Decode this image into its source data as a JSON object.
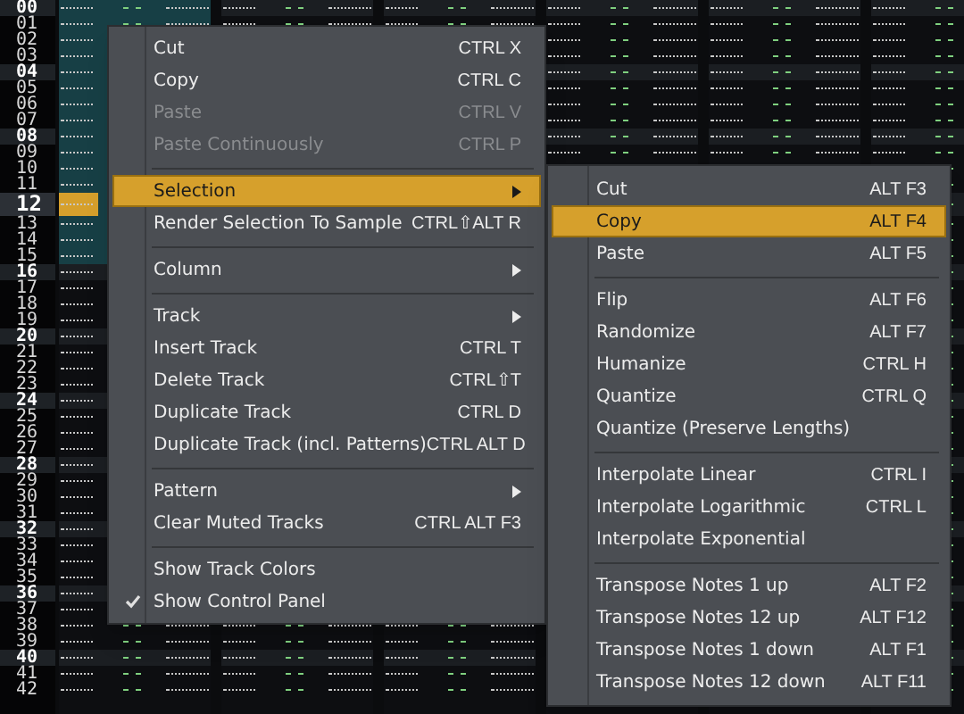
{
  "pattern": {
    "tracks": [
      {
        "selected": true
      },
      {
        "selected": false
      },
      {
        "selected": false
      },
      {
        "selected": false
      },
      {
        "selected": false
      },
      {
        "selected": false
      }
    ],
    "rows": [
      {
        "number": "00",
        "beat": true,
        "cursor": false,
        "selected": true
      },
      {
        "number": "01",
        "beat": false,
        "cursor": false,
        "selected": true
      },
      {
        "number": "02",
        "beat": false,
        "cursor": false,
        "selected": true
      },
      {
        "number": "03",
        "beat": false,
        "cursor": false,
        "selected": true
      },
      {
        "number": "04",
        "beat": true,
        "cursor": false,
        "selected": true
      },
      {
        "number": "05",
        "beat": false,
        "cursor": false,
        "selected": true
      },
      {
        "number": "06",
        "beat": false,
        "cursor": false,
        "selected": true
      },
      {
        "number": "07",
        "beat": false,
        "cursor": false,
        "selected": true
      },
      {
        "number": "08",
        "beat": true,
        "cursor": false,
        "selected": true
      },
      {
        "number": "09",
        "beat": false,
        "cursor": false,
        "selected": true
      },
      {
        "number": "10",
        "beat": false,
        "cursor": false,
        "selected": true
      },
      {
        "number": "11",
        "beat": false,
        "cursor": false,
        "selected": true
      },
      {
        "number": "12",
        "beat": true,
        "cursor": true,
        "selected": true
      },
      {
        "number": "13",
        "beat": false,
        "cursor": false,
        "selected": true
      },
      {
        "number": "14",
        "beat": false,
        "cursor": false,
        "selected": true
      },
      {
        "number": "15",
        "beat": false,
        "cursor": false,
        "selected": true
      },
      {
        "number": "16",
        "beat": true,
        "cursor": false,
        "selected": false
      },
      {
        "number": "17",
        "beat": false,
        "cursor": false,
        "selected": false
      },
      {
        "number": "18",
        "beat": false,
        "cursor": false,
        "selected": false
      },
      {
        "number": "19",
        "beat": false,
        "cursor": false,
        "selected": false
      },
      {
        "number": "20",
        "beat": true,
        "cursor": false,
        "selected": false
      },
      {
        "number": "21",
        "beat": false,
        "cursor": false,
        "selected": false
      },
      {
        "number": "22",
        "beat": false,
        "cursor": false,
        "selected": false
      },
      {
        "number": "23",
        "beat": false,
        "cursor": false,
        "selected": false
      },
      {
        "number": "24",
        "beat": true,
        "cursor": false,
        "selected": false
      },
      {
        "number": "25",
        "beat": false,
        "cursor": false,
        "selected": false
      },
      {
        "number": "26",
        "beat": false,
        "cursor": false,
        "selected": false
      },
      {
        "number": "27",
        "beat": false,
        "cursor": false,
        "selected": false
      },
      {
        "number": "28",
        "beat": true,
        "cursor": false,
        "selected": false
      },
      {
        "number": "29",
        "beat": false,
        "cursor": false,
        "selected": false
      },
      {
        "number": "30",
        "beat": false,
        "cursor": false,
        "selected": false
      },
      {
        "number": "31",
        "beat": false,
        "cursor": false,
        "selected": false
      },
      {
        "number": "32",
        "beat": true,
        "cursor": false,
        "selected": false
      },
      {
        "number": "33",
        "beat": false,
        "cursor": false,
        "selected": false
      },
      {
        "number": "34",
        "beat": false,
        "cursor": false,
        "selected": false
      },
      {
        "number": "35",
        "beat": false,
        "cursor": false,
        "selected": false
      },
      {
        "number": "36",
        "beat": true,
        "cursor": false,
        "selected": false
      },
      {
        "number": "37",
        "beat": false,
        "cursor": false,
        "selected": false
      },
      {
        "number": "38",
        "beat": false,
        "cursor": false,
        "selected": false
      },
      {
        "number": "39",
        "beat": false,
        "cursor": false,
        "selected": false
      },
      {
        "number": "40",
        "beat": true,
        "cursor": false,
        "selected": false
      },
      {
        "number": "41",
        "beat": false,
        "cursor": false,
        "selected": false
      },
      {
        "number": "42",
        "beat": false,
        "cursor": false,
        "selected": false
      }
    ]
  },
  "context_menu": {
    "items": [
      {
        "kind": "action",
        "label": "Cut",
        "shortcut": "CTRL X",
        "disabled": false
      },
      {
        "kind": "action",
        "label": "Copy",
        "shortcut": "CTRL C",
        "disabled": false
      },
      {
        "kind": "action",
        "label": "Paste",
        "shortcut": "CTRL V",
        "disabled": true
      },
      {
        "kind": "action",
        "label": "Paste Continuously",
        "shortcut": "CTRL P",
        "disabled": true
      },
      {
        "kind": "separator"
      },
      {
        "kind": "submenu",
        "label": "Selection",
        "selected": true
      },
      {
        "kind": "action",
        "label": "Render Selection To Sample",
        "shortcut": "CTRL⇧ALT R",
        "disabled": false
      },
      {
        "kind": "separator"
      },
      {
        "kind": "submenu",
        "label": "Column",
        "selected": false
      },
      {
        "kind": "separator"
      },
      {
        "kind": "submenu",
        "label": "Track",
        "selected": false
      },
      {
        "kind": "action",
        "label": "Insert Track",
        "shortcut": "CTRL T",
        "disabled": false
      },
      {
        "kind": "action",
        "label": "Delete Track",
        "shortcut": "CTRL⇧T",
        "disabled": false
      },
      {
        "kind": "action",
        "label": "Duplicate Track",
        "shortcut": "CTRL D",
        "disabled": false
      },
      {
        "kind": "action",
        "label": "Duplicate Track (incl. Patterns)",
        "shortcut": "CTRL ALT D",
        "disabled": false
      },
      {
        "kind": "separator"
      },
      {
        "kind": "submenu",
        "label": "Pattern",
        "selected": false
      },
      {
        "kind": "action",
        "label": "Clear Muted Tracks",
        "shortcut": "CTRL ALT F3",
        "disabled": false
      },
      {
        "kind": "separator"
      },
      {
        "kind": "toggle",
        "label": "Show Track Colors",
        "checked": false
      },
      {
        "kind": "toggle",
        "label": "Show Control Panel",
        "checked": true
      }
    ]
  },
  "selection_submenu": {
    "items": [
      {
        "kind": "action",
        "label": "Cut",
        "shortcut": "ALT F3",
        "selected": false
      },
      {
        "kind": "action",
        "label": "Copy",
        "shortcut": "ALT F4",
        "selected": true
      },
      {
        "kind": "action",
        "label": "Paste",
        "shortcut": "ALT F5",
        "selected": false
      },
      {
        "kind": "separator"
      },
      {
        "kind": "action",
        "label": "Flip",
        "shortcut": "ALT F6",
        "selected": false
      },
      {
        "kind": "action",
        "label": "Randomize",
        "shortcut": "ALT F7",
        "selected": false
      },
      {
        "kind": "action",
        "label": "Humanize",
        "shortcut": "CTRL H",
        "selected": false
      },
      {
        "kind": "action",
        "label": "Quantize",
        "shortcut": "CTRL Q",
        "selected": false
      },
      {
        "kind": "action",
        "label": "Quantize (Preserve Lengths)",
        "selected": false
      },
      {
        "kind": "separator"
      },
      {
        "kind": "action",
        "label": "Interpolate Linear",
        "shortcut": "CTRL I",
        "selected": false
      },
      {
        "kind": "action",
        "label": "Interpolate Logarithmic",
        "shortcut": "CTRL L",
        "selected": false
      },
      {
        "kind": "action",
        "label": "Interpolate Exponential",
        "selected": false
      },
      {
        "kind": "separator"
      },
      {
        "kind": "action",
        "label": "Transpose Notes 1 up",
        "shortcut": "ALT F2",
        "selected": false
      },
      {
        "kind": "action",
        "label": "Transpose Notes 12 up",
        "shortcut": "ALT F12",
        "selected": false
      },
      {
        "kind": "action",
        "label": "Transpose Notes 1 down",
        "shortcut": "ALT F1",
        "selected": false
      },
      {
        "kind": "action",
        "label": "Transpose Notes 12 down",
        "shortcut": "ALT F11",
        "selected": false
      }
    ]
  }
}
